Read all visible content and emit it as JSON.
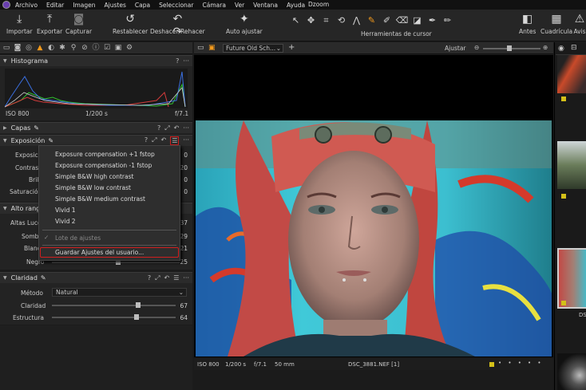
{
  "menubar": {
    "items": [
      "Archivo",
      "Editar",
      "Imagen",
      "Ajustes",
      "Capa",
      "Seleccionar",
      "Cámara",
      "Ver",
      "Ventana",
      "Ayuda"
    ],
    "app_name": "Dzoom"
  },
  "toolbar": {
    "importar": "Importar",
    "exportar": "Exportar",
    "capturar": "Capturar",
    "restablecer": "Restablecer",
    "deshacer": "Deshacer/Rehacer",
    "auto": "Auto ajustar",
    "herramientas": "Herramientas de cursor",
    "antes": "Antes",
    "cuadricula": "Cuadrícula",
    "avis": "Avis"
  },
  "histogram": {
    "title": "Histograma",
    "iso": "ISO 800",
    "shutter": "1/200 s",
    "aperture": "f/7.1"
  },
  "capas": {
    "title": "Capas"
  },
  "exposicion": {
    "title": "Exposición",
    "labels": [
      "Exposición",
      "Contraste",
      "Brillo",
      "Saturación"
    ],
    "values": [
      "0",
      "20",
      "0",
      "0"
    ]
  },
  "alto_rango": {
    "title": "Alto rango",
    "labels": [
      "Altas Luces",
      "Sombras",
      "Blanco",
      "Negro"
    ],
    "values": [
      "37",
      "29",
      "21",
      "25"
    ]
  },
  "dropdown_menu": {
    "items": [
      "Exposure compensation +1 fstop",
      "Exposure compensation -1 fstop",
      "Simple B&W high contrast",
      "Simple B&W low contrast",
      "Simple B&W medium contrast",
      "Vivid 1",
      "Vivid 2"
    ],
    "lote": "Lote de ajustes",
    "guardar": "Guardar Ajustes del usuario..."
  },
  "claridad": {
    "title": "Claridad",
    "metodo_label": "Método",
    "metodo_value": "Natural",
    "claridad_label": "Claridad",
    "claridad_value": "67",
    "estructura_label": "Estructura",
    "estructura_value": "64"
  },
  "viewer": {
    "style_select": "Future Old Sch...",
    "ajustar": "Ajustar",
    "iso": "ISO 800",
    "shutter": "1/200 s",
    "aperture": "f/7.1",
    "focal": "50 mm",
    "filename": "DSC_3881.NEF [1]"
  },
  "filmstrip": {
    "label": "DS"
  },
  "colors": {
    "accent": "#f39a1c",
    "highlight": "#d21f1f",
    "panel": "#232323",
    "star": "#d4c019"
  }
}
